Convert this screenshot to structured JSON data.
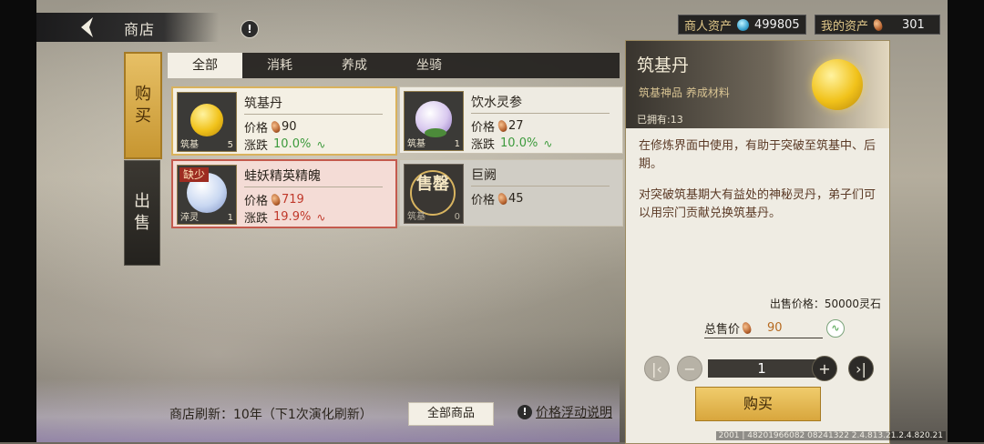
{
  "header": {
    "title": "商店",
    "merchant_assets_label": "商人资产",
    "merchant_assets_value": "499805",
    "my_assets_label": "我的资产",
    "my_assets_value": "301"
  },
  "side_tabs": [
    {
      "label": "购买",
      "chars": [
        "购",
        "买"
      ],
      "active": true
    },
    {
      "label": "出售",
      "chars": [
        "出",
        "售"
      ],
      "active": false
    }
  ],
  "category_tabs": [
    {
      "label": "全部",
      "active": true
    },
    {
      "label": "消耗",
      "active": false
    },
    {
      "label": "养成",
      "active": false
    },
    {
      "label": "坐骑",
      "active": false
    }
  ],
  "items": [
    {
      "name": "筑基丹",
      "price_label": "价格",
      "price": "90",
      "change_label": "涨跌",
      "change": "10.0%",
      "thumb_label": "筑基",
      "thumb_count": "5",
      "state": "selected"
    },
    {
      "name": "饮水灵参",
      "price_label": "价格",
      "price": "27",
      "change_label": "涨跌",
      "change": "10.0%",
      "thumb_label": "筑基",
      "thumb_count": "1",
      "state": "normal"
    },
    {
      "name": "蛙妖精英精魄",
      "price_label": "价格",
      "price": "719",
      "change_label": "涨跌",
      "change": "19.9%",
      "thumb_label": "淬灵",
      "thumb_count": "1",
      "badge": "缺少",
      "state": "short"
    },
    {
      "name": "巨阙",
      "price_label": "价格",
      "price": "45",
      "thumb_label": "筑基",
      "thumb_count": "0",
      "seal": "售罄",
      "state": "soldout"
    }
  ],
  "detail": {
    "name": "筑基丹",
    "tags": "筑基神品 养成材料",
    "owned": "已拥有:13",
    "desc1": "在修炼界面中使用，有助于突破至筑基中、后期。",
    "desc2": "对突破筑基期大有益处的神秘灵丹，弟子们可以用宗门贡献兑换筑基丹。",
    "sell_price": "出售价格：50000灵石",
    "total_label": "总售价",
    "total_value": "90",
    "quantity": "1",
    "buy_label": "购买"
  },
  "footer": {
    "refresh_text": "商店刷新：10年（下1次演化刷新）",
    "all_items_label": "全部商品",
    "price_help_label": "价格浮动说明",
    "version": "2001 | 48201966082 08241322 2.4.813.21.2.4.820.21"
  },
  "colors": {
    "gold_accent": "#d9b25c",
    "rise_green": "#3c9a3c",
    "rise_red": "#c0392b"
  }
}
